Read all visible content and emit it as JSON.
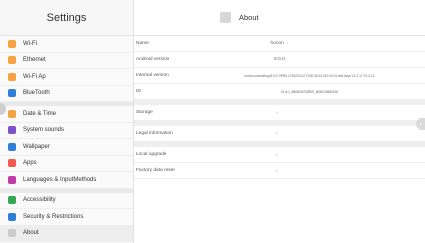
{
  "left": {
    "title": "Settings",
    "groups": [
      [
        {
          "label": "Wi-Fi",
          "color": "#f4a340",
          "icon": "wifi-icon"
        },
        {
          "label": "Ethernet",
          "color": "#f4a340",
          "icon": "ethernet-icon"
        },
        {
          "label": "Wi-Fi Ap",
          "color": "#f4a340",
          "icon": "hotspot-icon"
        },
        {
          "label": "BlueTooth",
          "color": "#2f7fd8",
          "icon": "bluetooth-icon"
        }
      ],
      [
        {
          "label": "Date & Time",
          "color": "#f4a340",
          "icon": "clock-icon"
        },
        {
          "label": "System sounds",
          "color": "#7b52c7",
          "icon": "sound-icon"
        },
        {
          "label": "Wallpaper",
          "color": "#2f7fd8",
          "icon": "wallpaper-icon"
        },
        {
          "label": "Apps",
          "color": "#f25b4b",
          "icon": "apps-icon"
        },
        {
          "label": "Languages & InputMethods",
          "color": "#c13aa7",
          "icon": "language-icon"
        }
      ],
      [
        {
          "label": "Accessibility",
          "color": "#34a853",
          "icon": "accessibility-icon"
        },
        {
          "label": "Security & Restrictions",
          "color": "#2f7fd8",
          "icon": "security-icon"
        },
        {
          "label": "About",
          "color": "#cccccc",
          "icon": "about-icon"
        }
      ]
    ]
  },
  "right": {
    "title": "About",
    "info": [
      {
        "label": "Name",
        "value": "horion",
        "chevron": "›"
      },
      {
        "label": "Android version",
        "value": "8.0.0"
      },
      {
        "label": "Internal version",
        "value": "horion-userdebug 8.0.0 OPR6.170623.014 TV00 06.24.010.04.01 test-keys V1.2.17 V1.3.12",
        "small": true
      },
      {
        "label": "ID",
        "value": "V1.6.1_8808C6702B0S_B06G19840240",
        "small": true
      }
    ],
    "actions": [
      [
        {
          "label": "Storage",
          "chevron": "›"
        }
      ],
      [
        {
          "label": "Legal information",
          "chevron": "›"
        }
      ],
      [
        {
          "label": "Local upgrade",
          "chevron": "›"
        },
        {
          "label": "Factory data reset",
          "chevron": "›"
        }
      ]
    ],
    "scroll_icon": "chevron-left-icon"
  }
}
